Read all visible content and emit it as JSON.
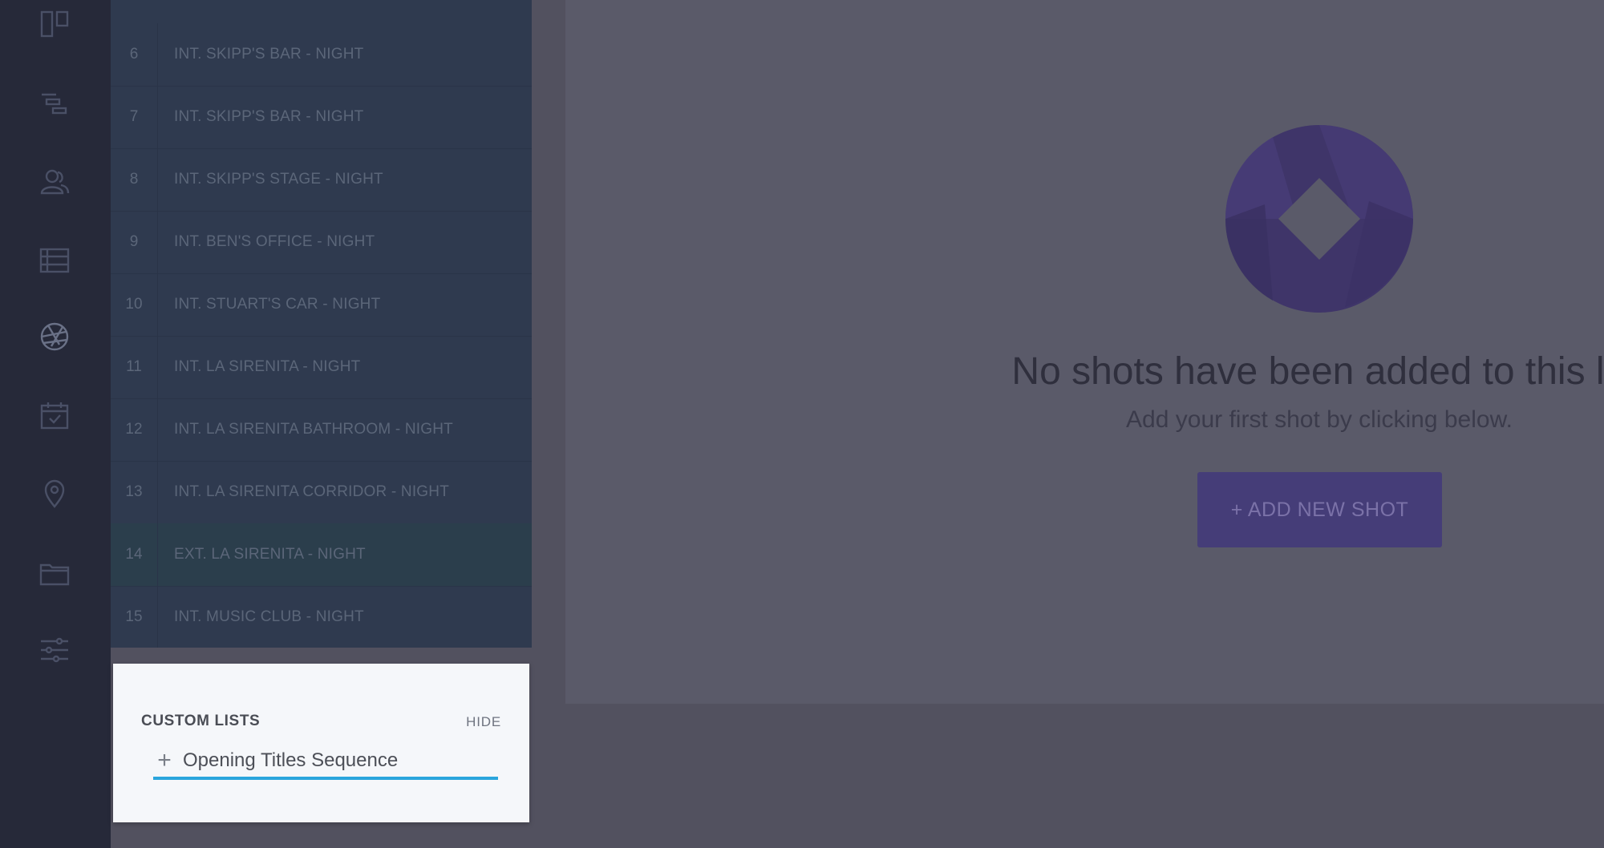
{
  "sidebar": {
    "icons": [
      "board-icon",
      "stripboard-icon",
      "cast-icon",
      "breakdown-icon",
      "shotlist-aperture-icon",
      "calendar-icon",
      "location-pin-icon",
      "folder-icon",
      "settings-sliders-icon"
    ]
  },
  "scenes": [
    {
      "number": "6",
      "title": "INT. SKIPP'S BAR - NIGHT"
    },
    {
      "number": "7",
      "title": "INT. SKIPP'S BAR - NIGHT"
    },
    {
      "number": "8",
      "title": "INT. SKIPP'S STAGE - NIGHT"
    },
    {
      "number": "9",
      "title": "INT. BEN'S OFFICE - NIGHT"
    },
    {
      "number": "10",
      "title": "INT. STUART'S CAR - NIGHT"
    },
    {
      "number": "11",
      "title": "INT. LA SIRENITA - NIGHT"
    },
    {
      "number": "12",
      "title": "INT. LA SIRENITA BATHROOM - NIGHT"
    },
    {
      "number": "13",
      "title": "INT. LA SIRENITA CORRIDOR - NIGHT"
    },
    {
      "number": "14",
      "title": "EXT. LA SIRENITA - NIGHT"
    },
    {
      "number": "15",
      "title": "INT. MUSIC CLUB - NIGHT"
    }
  ],
  "main": {
    "empty_title": "No shots have been added to this list",
    "empty_subtitle": "Add your first shot by clicking below.",
    "add_button": "+ ADD NEW SHOT"
  },
  "custom_lists": {
    "title": "CUSTOM LISTS",
    "hide_label": "HIDE",
    "input_value": "Opening Titles Sequence",
    "plus_glyph": "+"
  },
  "colors": {
    "accent": "#2aa5dd",
    "brand_purple": "#453d78"
  }
}
